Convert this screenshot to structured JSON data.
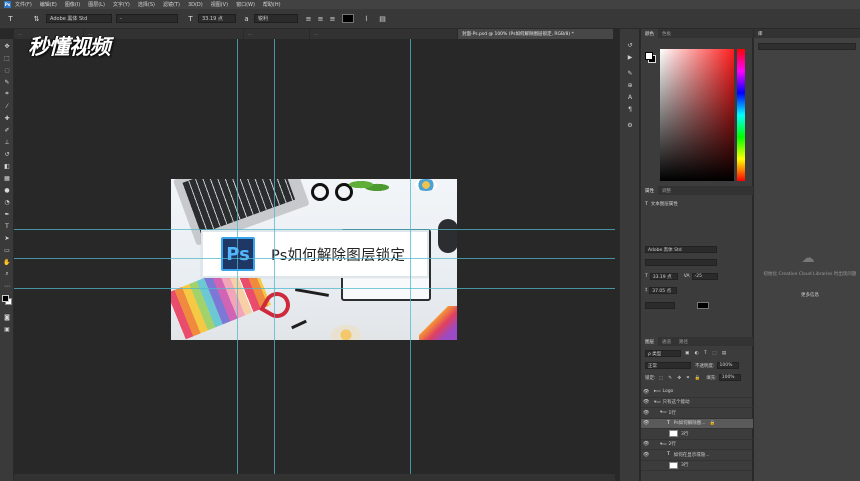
{
  "menubar": {
    "items": [
      "文件(F)",
      "编辑(E)",
      "图像(I)",
      "图层(L)",
      "文字(Y)",
      "选择(S)",
      "滤镜(T)",
      "3D(D)",
      "视图(V)",
      "窗口(W)",
      "帮助(H)"
    ]
  },
  "options": {
    "font_family": "Adobe 黑体 Std",
    "font_style": "-",
    "font_size": "33.19 点",
    "antialias": "锐利"
  },
  "tabs": [
    "...",
    "...",
    "...",
    "...",
    "封面-Ps.psd @ 100% (Ps如何解除图层锁定, RGB/8) *"
  ],
  "watermark": "秒懂视频",
  "document": {
    "title_text": "Ps如何解除图层锁定",
    "ps_badge": "Ps"
  },
  "panels": {
    "color_tabs": [
      "颜色",
      "色板"
    ],
    "properties_tabs": [
      "属性",
      "调整"
    ],
    "properties_heading": "文本图层属性",
    "prop_font": "Adobe 黑体 Std",
    "prop_size": "33.19 点",
    "prop_tracking": "-25",
    "prop_leading": "37.05 点",
    "layers_tabs": [
      "图层",
      "通道",
      "路径"
    ],
    "kind_label": "ρ 类型",
    "blend_mode": "正常",
    "opacity_label": "不透明度:",
    "opacity_value": "100%",
    "lock_label": "锁定:",
    "fill_label": "填充:",
    "fill_value": "100%",
    "layers": [
      {
        "name": "Logo",
        "type": "group"
      },
      {
        "name": "只有这个能动",
        "type": "group"
      },
      {
        "name": "1行",
        "type": "group"
      },
      {
        "name": "Ps如何解除图...",
        "type": "text"
      },
      {
        "name": "3行",
        "type": "shape"
      },
      {
        "name": "2行",
        "type": "group"
      },
      {
        "name": "如何在显示或隐...",
        "type": "text"
      },
      {
        "name": "3行",
        "type": "shape"
      }
    ]
  },
  "libraries": {
    "tab": "库",
    "message": "初始化 Creative Cloud Libraries 时出现问题",
    "more_info": "更多信息"
  }
}
